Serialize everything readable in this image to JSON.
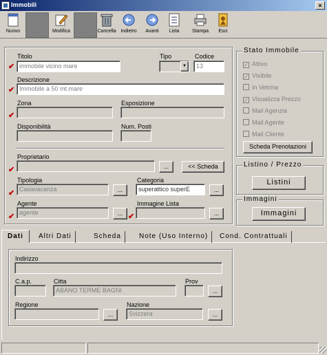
{
  "window": {
    "title": "Immobili",
    "min": "_",
    "max": "□",
    "close": "×"
  },
  "toolbar": [
    {
      "label": "Nuovo",
      "icon": "new-document-icon",
      "enabled": true
    },
    {
      "label": ". .",
      "icon": "disabled-icon",
      "enabled": false
    },
    {
      "label": "Modifica",
      "icon": "edit-pencil-icon",
      "enabled": true
    },
    {
      "label": ". .",
      "icon": "disabled-icon",
      "enabled": false
    },
    {
      "label": "Cancella",
      "icon": "trash-icon",
      "enabled": true
    },
    {
      "label": "Indietro",
      "icon": "back-arrow-icon",
      "enabled": true
    },
    {
      "label": "Avanti",
      "icon": "forward-arrow-icon",
      "enabled": true
    },
    {
      "label": "Lista",
      "icon": "list-icon",
      "enabled": true
    },
    {
      "label": "Stampa",
      "icon": "printer-icon",
      "enabled": true
    },
    {
      "label": "Esci",
      "icon": "exit-icon",
      "enabled": true
    }
  ],
  "form": {
    "titolo_label": "Titolo",
    "titolo_value": "immobile vicino mare",
    "tipo_label": "Tipo",
    "tipo_value": "",
    "codice_label": "Codice",
    "codice_value": "13",
    "descrizione_label": "Descrizione",
    "descrizione_value": "Immobile a 50 mt.mare",
    "zona_label": "Zona",
    "zona_value": "",
    "esposizione_label": "Esposizione",
    "esposizione_value": "",
    "disponibilita_label": "Disponibilità",
    "disponibilita_value": "",
    "num_posti_label": "Num. Posti",
    "num_posti_value": "",
    "proprietario_label": "Proprietario",
    "proprietario_value": "",
    "scheda_button": "<< Scheda",
    "tipologia_label": "Tipologia",
    "tipologia_value": "Casavacanza",
    "categoria_label": "Categoria",
    "categoria_value": "superattico superE",
    "agente_label": "Agente",
    "agente_value": "agente",
    "immagine_lista_label": "Immagine Lista",
    "immagine_lista_value": "",
    "ellipsis": "..."
  },
  "stato": {
    "title": "Stato Immobile",
    "items": [
      {
        "label": "Attivo",
        "checked": true
      },
      {
        "label": "Visibile",
        "checked": true
      },
      {
        "label": "In Vetrina",
        "checked": false
      },
      {
        "label": "Visualizza Prezzo",
        "checked": true
      },
      {
        "label": "Mail Agenzia",
        "checked": false
      },
      {
        "label": "Mail Agente",
        "checked": false
      },
      {
        "label": "Mail Cliente",
        "checked": false
      }
    ],
    "scheda_prenotazioni": "Scheda Prenotazioni"
  },
  "listino": {
    "title": "Listino / Prezzo",
    "button": "Listini"
  },
  "immagini": {
    "title": "Immagini",
    "button": "Immagini"
  },
  "tabs": [
    "Dati",
    "Altri Dati",
    "Scheda",
    "Note (Uso Interno)",
    "Cond. Contrattuali"
  ],
  "dati": {
    "indirizzo_label": "Indirizzo",
    "indirizzo_value": "",
    "cap_label": "C.a.p.",
    "cap_value": "",
    "citta_label": "Citta",
    "citta_value": "ABANO TERME BAGNI",
    "prov_label": "Prov",
    "prov_value": "",
    "regione_label": "Regione",
    "regione_value": "",
    "nazione_label": "Nazione",
    "nazione_value": "Svizzera"
  },
  "colors": {
    "required_tick": "#c00000",
    "titlebar_start": "#0a246a",
    "titlebar_end": "#a6caf0"
  }
}
